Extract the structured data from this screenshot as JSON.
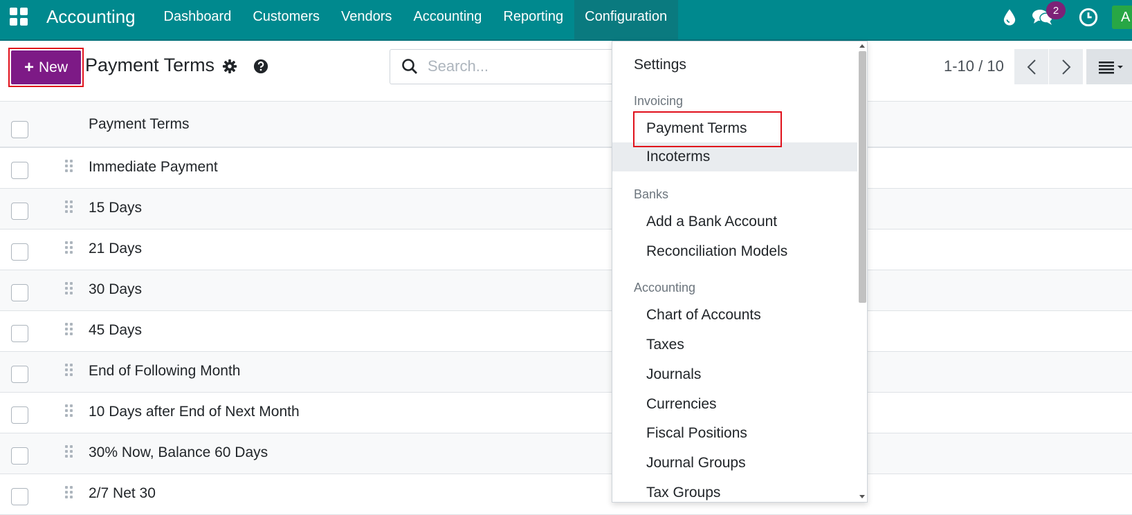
{
  "navbar": {
    "brand": "Accounting",
    "menu": [
      "Dashboard",
      "Customers",
      "Vendors",
      "Accounting",
      "Reporting",
      "Configuration"
    ],
    "active_menu": "Configuration",
    "messages_badge": "2",
    "avatar_letter": "A"
  },
  "control_panel": {
    "new_label": "New",
    "title": "Payment Terms",
    "search_placeholder": "Search...",
    "pager": "1-10 / 10"
  },
  "list": {
    "column_header": "Payment Terms",
    "rows": [
      "Immediate Payment",
      "15 Days",
      "21 Days",
      "30 Days",
      "45 Days",
      "End of Following Month",
      "10 Days after End of Next Month",
      "30% Now, Balance 60 Days",
      "2/7 Net 30"
    ]
  },
  "dropdown": {
    "settings": "Settings",
    "sections": [
      {
        "header": "Invoicing",
        "items": [
          "Payment Terms",
          "Incoterms"
        ]
      },
      {
        "header": "Banks",
        "items": [
          "Add a Bank Account",
          "Reconciliation Models"
        ]
      },
      {
        "header": "Accounting",
        "items": [
          "Chart of Accounts",
          "Taxes",
          "Journals",
          "Currencies",
          "Fiscal Positions",
          "Journal Groups",
          "Tax Groups"
        ]
      }
    ]
  },
  "colors": {
    "navbar": "#00898e",
    "primary": "#7d1a86",
    "highlight": "#e0101b"
  }
}
